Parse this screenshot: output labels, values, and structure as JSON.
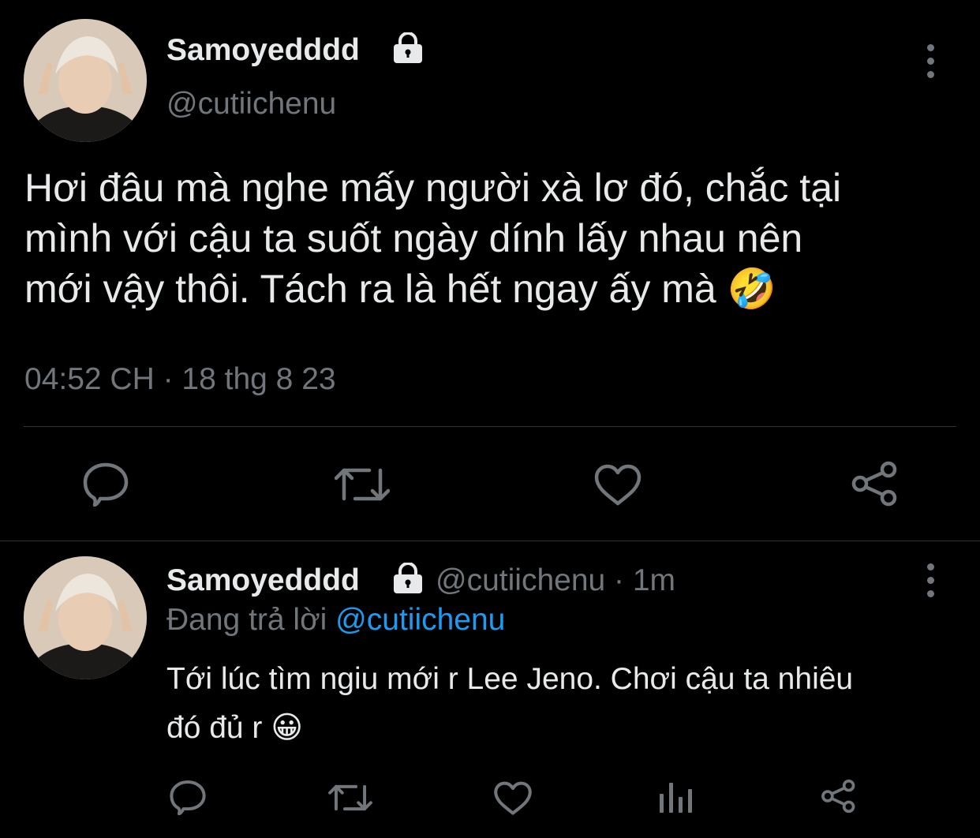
{
  "main_tweet": {
    "display_name": "Samoyedddd",
    "handle": "@cutiichenu",
    "text_lines": [
      "Hơi đâu mà nghe mấy người xà lơ đó, chắc tại",
      "mình với cậu ta suốt ngày dính lấy nhau nên",
      "mới vậy thôi. Tách ra là hết ngay ấy mà 🤣"
    ],
    "timestamp": "04:52 CH · 18 thg 8 23",
    "icons": [
      "comment-icon",
      "retweet-icon",
      "like-icon",
      "share-icon"
    ]
  },
  "reply_tweet": {
    "display_name": "Samoyedddd",
    "handle_time": "@cutiichenu · 1m",
    "replying_prefix": "Đang trả lời",
    "replying_to": "@cutiichenu",
    "text_lines": [
      "Tới lúc tìm ngiu mới r Lee Jeno. Chơi cậu ta nhiêu",
      "đó đủ r 😀"
    ],
    "icons": [
      "comment-icon",
      "retweet-icon",
      "like-icon",
      "analytics-icon",
      "share-icon"
    ]
  },
  "colors": {
    "background": "#000000",
    "text": "#e7e9ea",
    "muted": "#71767b",
    "link": "#1d9bf0",
    "divider": "#2f3336"
  }
}
